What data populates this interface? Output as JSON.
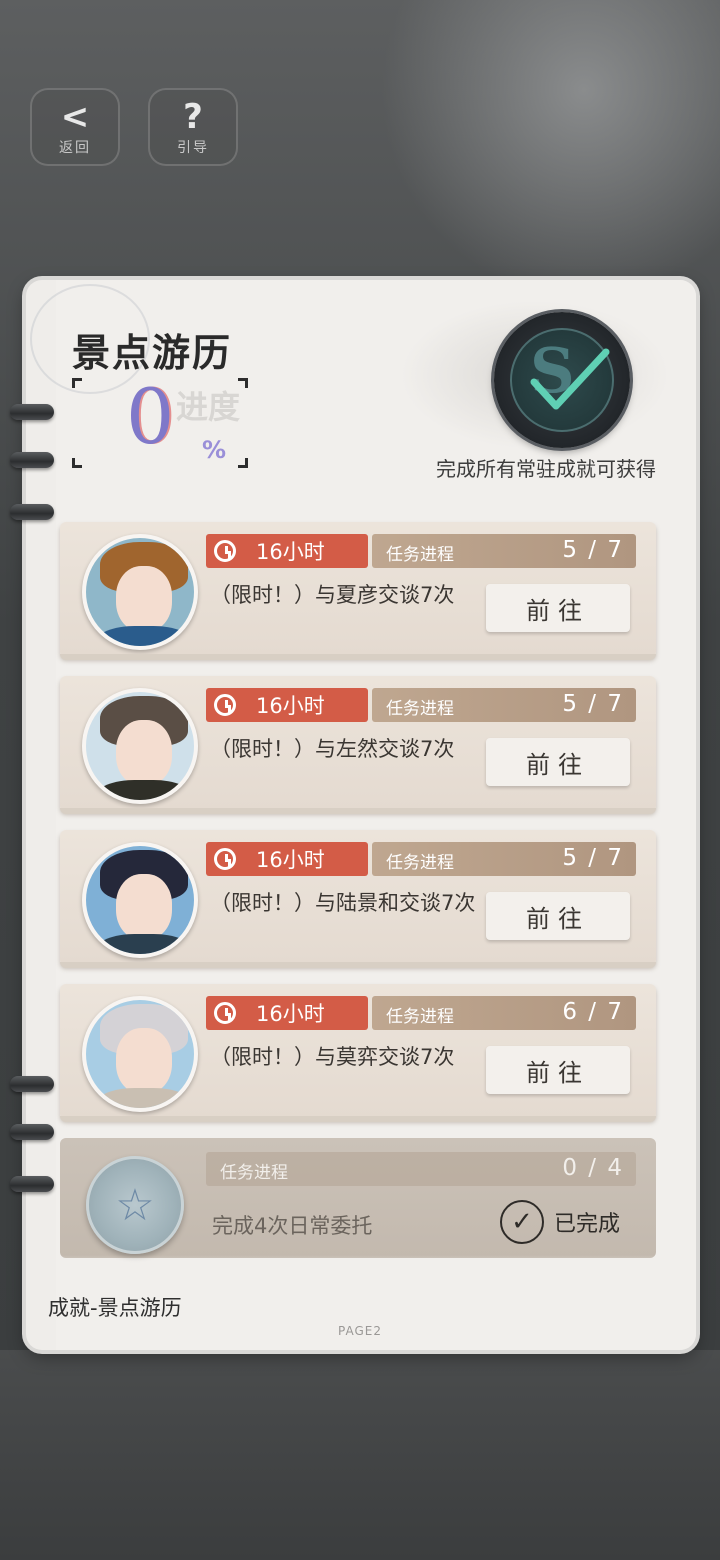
{
  "top_buttons": {
    "back_label": "返回",
    "guide_label": "引导"
  },
  "header": {
    "title": "景点游历",
    "progress_value": "0",
    "progress_label": "进度",
    "progress_unit": "%",
    "badge_caption": "完成所有常驻成就可获得"
  },
  "tasks": [
    {
      "timer": "16小时",
      "progress_label": "任务进程",
      "progress": "5 / 7",
      "description": "（限时！）与夏彦交谈7次",
      "button": "前往"
    },
    {
      "timer": "16小时",
      "progress_label": "任务进程",
      "progress": "5 / 7",
      "description": "（限时！）与左然交谈7次",
      "button": "前往"
    },
    {
      "timer": "16小时",
      "progress_label": "任务进程",
      "progress": "5 / 7",
      "description": "（限时！）与陆景和交谈7次",
      "button": "前往"
    },
    {
      "timer": "16小时",
      "progress_label": "任务进程",
      "progress": "6 / 7",
      "description": "（限时！）与莫弈交谈7次",
      "button": "前往"
    }
  ],
  "done_task": {
    "progress_label": "任务进程",
    "progress": "0 / 4",
    "description": "完成4次日常委托",
    "status": "已完成"
  },
  "footer": {
    "title": "成就-景点游历",
    "page": "PAGE2"
  },
  "colors": {
    "timer_red": "#d35c47",
    "progress_brown": "#b09680",
    "percent_purple": "#7f78c9"
  }
}
